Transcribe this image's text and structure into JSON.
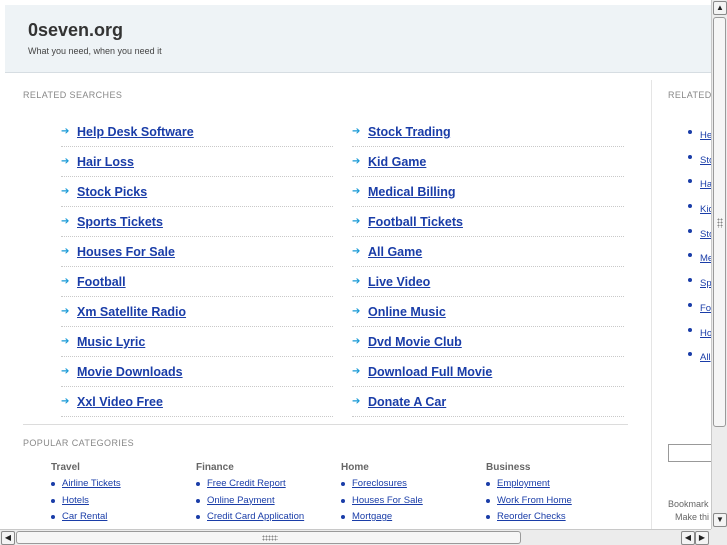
{
  "header": {
    "title": "0seven.org",
    "tagline": "What you need, when you need it"
  },
  "related_searches": {
    "title": "RELATED SEARCHES",
    "left": [
      "Help Desk Software",
      "Hair Loss",
      "Stock Picks",
      "Sports Tickets",
      "Houses For Sale",
      "Football",
      "Xm Satellite Radio",
      "Music Lyric",
      "Movie Downloads",
      "Xxl Video Free"
    ],
    "right": [
      "Stock Trading",
      "Kid Game",
      "Medical Billing",
      "Football Tickets",
      "All Game",
      "Live Video",
      "Online Music",
      "Dvd Movie Club",
      "Download Full Movie",
      "Donate A Car"
    ],
    "arrow_icon": "arrow-right-icon"
  },
  "popular_categories": {
    "title": "POPULAR CATEGORIES",
    "columns": [
      {
        "heading": "Travel",
        "items": [
          "Airline Tickets",
          "Hotels",
          "Car Rental"
        ]
      },
      {
        "heading": "Finance",
        "items": [
          "Free Credit Report",
          "Online Payment",
          "Credit Card Application"
        ]
      },
      {
        "heading": "Home",
        "items": [
          "Foreclosures",
          "Houses For Sale",
          "Mortgage"
        ]
      },
      {
        "heading": "Business",
        "items": [
          "Employment",
          "Work From Home",
          "Reorder Checks"
        ]
      }
    ]
  },
  "sidebar": {
    "title": "RELATED",
    "items": [
      "He",
      "Sto",
      "Ha",
      "Kid",
      "Sto",
      "Me",
      "Sp",
      "Fo",
      "Ho",
      "All"
    ],
    "bookmark": "Bookmark",
    "make_this": "Make thi"
  },
  "scrollbars": {
    "up": "▲",
    "down": "▼",
    "left": "◀",
    "right": "▶"
  },
  "colors": {
    "link": "#1a3da8",
    "arrow": "#1a9ad6",
    "header_bg": "#eef3f6"
  }
}
